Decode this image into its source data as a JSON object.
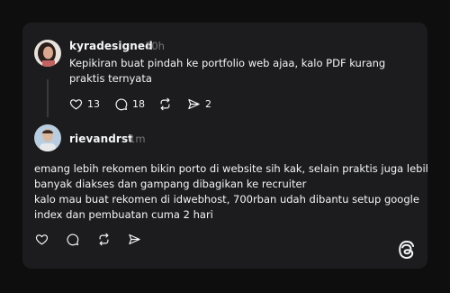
{
  "post": {
    "author": "kyradesigned",
    "time": "10h",
    "lines": [
      "Kepikiran buat pindah ke portfolio web ajaa, kalo PDF kurang",
      "praktis ternyata"
    ],
    "actions": {
      "likes": "13",
      "replies": "18",
      "shares": "2"
    }
  },
  "reply": {
    "author": "rievandrst",
    "time": "1m",
    "lines": [
      "emang lebih rekomen bikin porto di website sih kak, selain praktis juga lebih",
      "banyak diakses dan gampang dibagikan ke recruiter",
      "kalo mau buat rekomen di idwebhost, 700rban udah dibantu setup google",
      "index dan pembuatan cuma 2 hari"
    ]
  },
  "colors": {
    "background": "#0e0e0e",
    "card": "#1c1c1e",
    "text": "#f3f5f7",
    "muted": "#777777"
  },
  "icons": {
    "like": "heart-icon",
    "reply": "comment-icon",
    "repost": "repost-icon",
    "share": "send-icon",
    "brand": "threads-logo"
  }
}
